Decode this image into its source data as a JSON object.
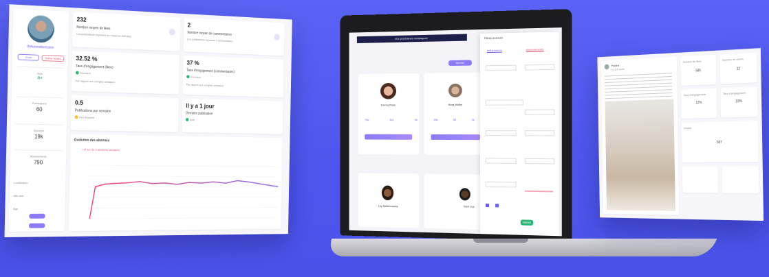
{
  "left": {
    "profile_name": "thekeenobsession",
    "buttons": [
      "Profil",
      "Retirer la liste"
    ],
    "side_stats": [
      {
        "label": "Note",
        "value": "A+"
      },
      {
        "label": "Publications",
        "value": "60"
      },
      {
        "label": "Abonnés",
        "value": "19k"
      },
      {
        "label": "Abonnements",
        "value": "790"
      }
    ],
    "side_info": [
      "Localisation",
      "Site web",
      "Âge"
    ],
    "stats": [
      {
        "value": "232",
        "label": "Nombre moyen de likes",
        "sub": "Les publications reçoivent en moyenne 232 likes"
      },
      {
        "value": "2",
        "label": "Nombre moyen de commentaires",
        "sub": "Les publications reçoivent 2 commentaires"
      },
      {
        "value": "32.52 %",
        "label": "Taux d'engagement (likes)",
        "badge": "Excellent",
        "sub": "Par rapport aux comptes similaires"
      },
      {
        "value": "37 %",
        "label": "Taux d'engagement (commentaires)",
        "badge": "Excellent",
        "sub": "Par rapport aux comptes similaires"
      },
      {
        "value": "0.5",
        "label": "Publications par semaine",
        "badge": "Peu fréquent"
      },
      {
        "value": "Il y a 1 jour",
        "label": "Dernière publication",
        "badge": "Actif"
      }
    ],
    "chart_title": "Évolution des abonnés",
    "chart_sub": "+17 sur les 3 dernières semaines",
    "chart_color_a": "#f0426b",
    "chart_color_b": "#8a64f0"
  },
  "laptop": {
    "banner": "Vos prochaines campagnes",
    "filters_title": "Filtres avancés",
    "tab_a": "Influenceurs",
    "tab_b": "Abonnements",
    "top_button": "Ajouter",
    "profile_names": [
      "Emma Rose",
      "Nora Muller",
      "Lily Bellefontaine",
      "Sam Lee"
    ],
    "profile_stats": [
      [
        "79k",
        "301",
        "9k"
      ],
      [
        "49k",
        "92",
        "2k"
      ]
    ],
    "submit": "Valider"
  },
  "right": {
    "post_user": "Pauline",
    "post_sub": "Il y a 2 jours",
    "metrics": [
      {
        "label": "Nombre de likes",
        "value": "585"
      },
      {
        "label": "Nombre de comm.",
        "value": "12"
      },
      {
        "label": "Taux d'engagement",
        "value": "12%"
      },
      {
        "label": "Taux d'engagement",
        "value": "23%"
      },
      {
        "label": "Portée",
        "value": "587"
      }
    ]
  }
}
